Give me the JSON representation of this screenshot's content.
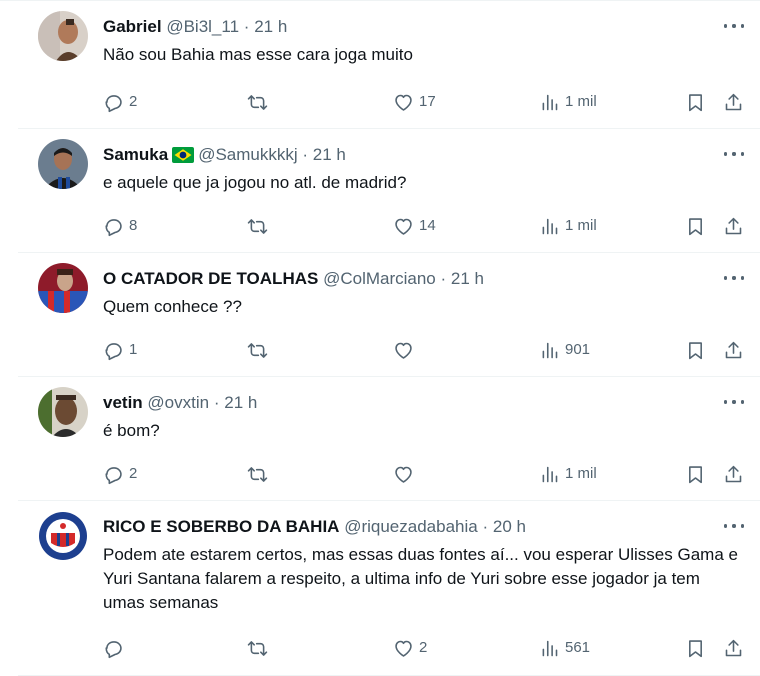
{
  "replies": [
    {
      "name": "Gabriel",
      "handle": "@Bi3l_11",
      "sep": "·",
      "time": "21 h",
      "text": "Não sou Bahia mas esse cara joga muito",
      "replies": "2",
      "retweets": "",
      "likes": "17",
      "views": "1 mil",
      "avatar_colors": [
        "#c9bfb8",
        "#5a3e2b",
        "#d8d0c8"
      ]
    },
    {
      "name": "Samuka",
      "flag": "brazil-flag",
      "handle": "@Samukkkkj",
      "sep": "·",
      "time": "21 h",
      "text": "e aquele que ja jogou no atl. de madrid?",
      "replies": "8",
      "retweets": "",
      "likes": "14",
      "views": "1 mil",
      "avatar_colors": [
        "#1a1a1a",
        "#1e4b9c",
        "#6b7d8f"
      ]
    },
    {
      "name": "O CATADOR DE TOALHAS",
      "handle": "@ColMarciano",
      "sep": "·",
      "time": "21 h",
      "text": "Quem conhece ??",
      "replies": "1",
      "retweets": "",
      "likes": "",
      "views": "901",
      "avatar_colors": [
        "#8e1b2a",
        "#2a56b8",
        "#c9a48a"
      ]
    },
    {
      "name": "vetin",
      "handle": "@ovxtin",
      "sep": "·",
      "time": "21 h",
      "text": "é bom?",
      "replies": "2",
      "retweets": "",
      "likes": "",
      "views": "1 mil",
      "avatar_colors": [
        "#4c6e2f",
        "#6b4a33",
        "#d7d2c7"
      ]
    },
    {
      "name": "RICO E SOBERBO DA BAHIA",
      "handle": "@riquezadabahia",
      "sep": "·",
      "time": "20 h",
      "text": "Podem ate estarem certos, mas essas duas fontes aí... vou esperar Ulisses Gama e Yuri Santana falarem a respeito, a ultima info de Yuri sobre esse jogador ja tem umas semanas",
      "replies": "",
      "retweets": "",
      "likes": "2",
      "views": "561",
      "avatar_colors": [
        "#1d3f8f",
        "#d42a2a",
        "#ffffff"
      ]
    }
  ],
  "icons": {
    "more": "more-dots-icon",
    "reply": "reply-icon",
    "retweet": "retweet-icon",
    "like": "like-heart-icon",
    "views": "views-chart-icon",
    "bookmark": "bookmark-icon",
    "share": "share-icon"
  },
  "colors": {
    "text": "#0f1419",
    "muted": "#536471",
    "divider": "#eff3f4",
    "flag_green": "#009c3b",
    "flag_yellow": "#ffdf00",
    "flag_blue": "#002776"
  }
}
